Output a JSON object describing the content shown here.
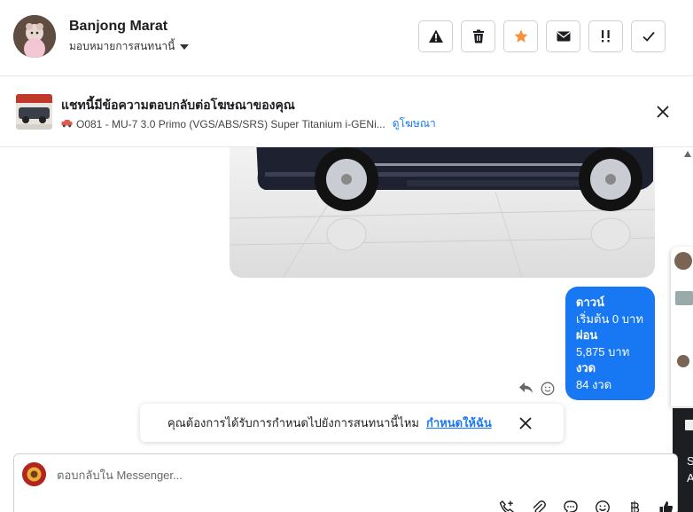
{
  "contact": {
    "name": "Banjong Marat",
    "assign_label": "มอบหมายการสนทนานี้"
  },
  "toolbar": [
    {
      "icon": "warning-icon",
      "name": "mark-spam-button"
    },
    {
      "icon": "trash-icon",
      "name": "delete-button"
    },
    {
      "icon": "star-icon",
      "name": "star-button",
      "color": "#f7923b"
    },
    {
      "icon": "envelope-icon",
      "name": "mark-unread-button"
    },
    {
      "icon": "follow-up-icon",
      "name": "follow-up-button"
    },
    {
      "icon": "check-icon",
      "name": "mark-done-button"
    }
  ],
  "ad_banner": {
    "title": "แชทนี้มีข้อความตอบกลับต่อโฆษณาของคุณ",
    "ad_text": "O081 - MU-7 3.0 Primo (VGS/ABS/SRS) Super Titanium i-GENi...",
    "link": "ดูโฆษณา"
  },
  "message": {
    "lines": [
      "ดาวน์",
      "เริ่มต้น 0 บาท",
      "ผ่อน",
      "5,875 บาท",
      "งวด",
      "84 งวด"
    ],
    "color": "#1877f2"
  },
  "toast": {
    "text": "คุณต้องการได้รับการกำหนดไปยังการสนทนานี้ไหม",
    "link": "กำหนดให้ฉัน"
  },
  "side_panel": {
    "text_line1": "S",
    "text_line2": "A"
  },
  "composer": {
    "placeholder": "ตอบกลับใน Messenger...",
    "icons": [
      "phone-add-icon",
      "paperclip-icon",
      "saved-replies-icon",
      "emoji-icon",
      "baht-icon",
      "thumbs-up-icon"
    ]
  }
}
